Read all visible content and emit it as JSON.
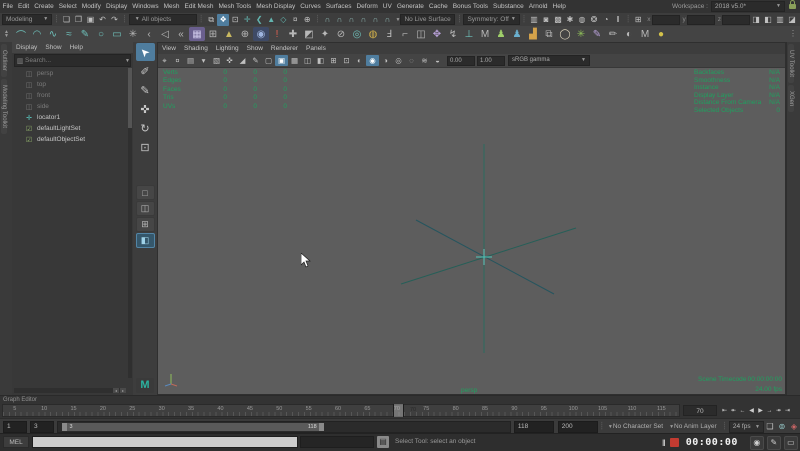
{
  "colors": {
    "accent": "#5285a6",
    "hud_green": "#1fa15f",
    "icon_teal": "#63b4af",
    "viewport_bg": "#5d5d5d",
    "record_red": "#c23b31"
  },
  "menubar": {
    "menus": [
      "File",
      "Edit",
      "Create",
      "Select",
      "Modify",
      "Display",
      "Windows",
      "Mesh",
      "Edit Mesh",
      "Mesh Tools",
      "Mesh Display",
      "Curves",
      "Surfaces",
      "Deform",
      "UV",
      "Generate",
      "Cache",
      "Bonus Tools",
      "Substance",
      "Arnold",
      "Help"
    ],
    "workspace_label": "Workspace :",
    "workspace_value": "2018 v5.0*"
  },
  "statusline": {
    "mode": "Modeling",
    "file_icons": [
      {
        "n": "new-scene-icon",
        "g": "❏"
      },
      {
        "n": "open-scene-icon",
        "g": "❐"
      },
      {
        "n": "save-scene-icon",
        "g": "▣"
      },
      {
        "n": "undo-icon",
        "g": "↶"
      },
      {
        "n": "redo-icon",
        "g": "↷"
      }
    ],
    "selection_filter": "All objects",
    "mask_icons": [
      {
        "n": "select-by-hierarchy-icon",
        "g": "⧉"
      },
      {
        "n": "select-by-object-icon",
        "g": "❖",
        "hl": 1
      },
      {
        "n": "select-by-component-icon",
        "g": "⊡"
      }
    ],
    "toggle_icons": [
      {
        "n": "soft-select-icon",
        "g": "✛",
        "c": "#63b4af"
      },
      {
        "n": "reflection-icon",
        "g": "❮",
        "c": "#63b4af"
      },
      {
        "n": "preserve-children-icon",
        "g": "▲",
        "c": "#63b4af"
      },
      {
        "n": "preserve-uv-icon",
        "g": "◇",
        "c": "#63b4af"
      },
      {
        "n": "lock-selection-icon",
        "g": "¤"
      },
      {
        "n": "track-selection-icon",
        "g": "⊕"
      }
    ],
    "snap_icons": [
      {
        "n": "snap-to-grids-icon",
        "g": "∩",
        "c": "#8fb8b4"
      },
      {
        "n": "snap-to-curves-icon",
        "g": "∩",
        "c": "#8fb8b4"
      },
      {
        "n": "snap-to-points-icon",
        "g": "∩",
        "c": "#8fb8b4"
      },
      {
        "n": "snap-to-projected-center-icon",
        "g": "∩",
        "c": "#8fb8b4"
      },
      {
        "n": "snap-to-view-planes-icon",
        "g": "∩",
        "c": "#8fb8b4"
      },
      {
        "n": "make-live-icon",
        "g": "∩",
        "c": "#8fb8b4"
      }
    ],
    "live_surface": "No Live Surface",
    "symmetry": "Symmetry: Off",
    "render_icons": [
      {
        "n": "render-view-icon",
        "g": "▥"
      },
      {
        "n": "render-current-frame-icon",
        "g": "◙"
      },
      {
        "n": "ipr-render-icon",
        "g": "▩"
      },
      {
        "n": "render-settings-icon",
        "g": "✱"
      },
      {
        "n": "hypershade-icon",
        "g": "◍"
      },
      {
        "n": "light-editor-icon",
        "g": "❂"
      },
      {
        "n": "render-setup-icon",
        "g": "◔"
      },
      {
        "n": "pause-viewport-icon",
        "g": "‖"
      }
    ],
    "coord_icon": "⊞",
    "coord_labels": [
      "x",
      "y",
      "z"
    ],
    "right_icons": [
      {
        "n": "attribute-editor-toggle-icon",
        "g": "◨"
      },
      {
        "n": "tool-settings-toggle-icon",
        "g": "◧"
      },
      {
        "n": "channel-box-toggle-icon",
        "g": "▥"
      },
      {
        "n": "workspace-controls-icon",
        "g": "◪"
      }
    ]
  },
  "shelf": {
    "icons": [
      {
        "n": "two-point-arc-tool",
        "g": "⌒",
        "c": "#6ec0ba"
      },
      {
        "n": "three-point-arc-tool",
        "g": "◠",
        "c": "#6ec0ba"
      },
      {
        "n": "cv-curve-tool",
        "g": "∿",
        "c": "#6ec0ba"
      },
      {
        "n": "ep-curve-tool",
        "g": "≈",
        "c": "#6ec0ba"
      },
      {
        "n": "pencil-curve-tool",
        "g": "✎",
        "c": "#6ec0ba"
      },
      {
        "n": "nurbs-circle-tool",
        "g": "○",
        "c": "#6ec0ba"
      },
      {
        "n": "nurbs-square-tool",
        "g": "▭",
        "c": "#6ec0ba"
      },
      {
        "n": "text-curves-tool",
        "g": "✳"
      },
      {
        "n": "attach-curves-tool",
        "g": "‹"
      },
      {
        "n": "detach-curves-tool",
        "g": "◁"
      },
      {
        "n": "insert-knot-tool",
        "g": "«"
      },
      {
        "n": "bonus-grid-tool",
        "g": "▦",
        "c": "#cfc8ea",
        "b": "#6a5f8e"
      },
      {
        "n": "lattice-tool",
        "g": "⊞"
      },
      {
        "n": "sculpt-tool",
        "g": "▲",
        "c": "#c8b860"
      },
      {
        "n": "wrap-deformer-tool",
        "g": "⊕"
      },
      {
        "n": "substance-node-tool",
        "g": "◉",
        "c": "#9fb6e0",
        "b": "#3e4a66"
      },
      {
        "n": "warning-badge-tool",
        "g": "!",
        "c": "#e06050"
      },
      {
        "n": "cluster-tool",
        "g": "✚"
      },
      {
        "n": "blend-shape-tool",
        "g": "◩"
      },
      {
        "n": "skin-bind-tool",
        "g": "✦"
      },
      {
        "n": "nonlinear-deformer-tool",
        "g": "⊘"
      },
      {
        "n": "jiggle-deformer-tool",
        "g": "◎",
        "c": "#6ec0ba"
      },
      {
        "n": "cluster-handle-tool",
        "g": "◍",
        "c": "#d4b24a"
      },
      {
        "n": "ik-handle-tool",
        "g": "Ⅎ"
      },
      {
        "n": "joint-tool",
        "g": "⌐"
      },
      {
        "n": "mirror-joint-tool",
        "g": "◫"
      },
      {
        "n": "hik-character-tool",
        "g": "✥",
        "c": "#b8a0d8"
      },
      {
        "n": "ik-spline-tool",
        "g": "↯"
      },
      {
        "n": "mash-network-tool",
        "g": "⊥",
        "c": "#6ec0ba"
      },
      {
        "n": "mash-editor-tool",
        "g": "M"
      },
      {
        "n": "trs-node-tool",
        "g": "♟",
        "c": "#9fcf6a"
      },
      {
        "n": "mp-node-tool",
        "g": "♟",
        "c": "#6ab0cf"
      },
      {
        "n": "profiler-tool",
        "g": "▟",
        "c": "#d4a24a"
      },
      {
        "n": "lattice-pair-tool",
        "g": "⧉"
      },
      {
        "n": "xgen-egg-tool",
        "g": "◯",
        "c": "#d8d0b8"
      },
      {
        "n": "xgen-plant-tool",
        "g": "✳",
        "c": "#8fbf5a"
      },
      {
        "n": "paint-effects-brush-tool",
        "g": "✎",
        "c": "#b8a0d8"
      },
      {
        "n": "paint-effects-preset-tool",
        "g": "✏"
      },
      {
        "n": "yin-yang-tool",
        "g": "◐"
      },
      {
        "n": "mash-m-tool",
        "g": "M"
      },
      {
        "n": "sphere-preset-tool",
        "g": "●",
        "c": "#d4c24a"
      }
    ]
  },
  "side_tabs": {
    "left": [
      "Outliner",
      "Modeling Toolkit"
    ],
    "right": [
      "UV Toolkit",
      "XGen"
    ]
  },
  "outliner": {
    "menus": [
      "Display",
      "Show",
      "Help"
    ],
    "search_placeholder": "Search...",
    "items": [
      {
        "label": "persp",
        "icon": "camera-icon",
        "ig": "◫",
        "ic": "#777",
        "cls": "dim"
      },
      {
        "label": "top",
        "icon": "camera-icon",
        "ig": "◫",
        "ic": "#777",
        "cls": "dim"
      },
      {
        "label": "front",
        "icon": "camera-icon",
        "ig": "◫",
        "ic": "#777",
        "cls": "dim"
      },
      {
        "label": "side",
        "icon": "camera-icon",
        "ig": "◫",
        "ic": "#777",
        "cls": "dim"
      },
      {
        "label": "locator1",
        "icon": "locator-icon",
        "ig": "✛",
        "ic": "#5bc8c0"
      },
      {
        "label": "defaultLightSet",
        "icon": "set-icon",
        "ig": "☑",
        "ic": "#8fae6a"
      },
      {
        "label": "defaultObjectSet",
        "icon": "set-icon",
        "ig": "☑",
        "ic": "#8fae6a"
      }
    ]
  },
  "toolbox": {
    "tools": [
      {
        "n": "select-tool",
        "g": "➤",
        "cls": "rot",
        "hl": 1
      },
      {
        "n": "lasso-tool",
        "g": "✐"
      },
      {
        "n": "paint-select-tool",
        "g": "✎"
      },
      {
        "n": "move-tool",
        "g": "✜"
      },
      {
        "n": "rotate-tool",
        "g": "↻"
      },
      {
        "n": "scale-tool",
        "g": "⊡"
      }
    ],
    "layouts": [
      {
        "n": "layout-single-pane-button",
        "g": "□"
      },
      {
        "n": "layout-two-panes-button",
        "g": "◫"
      },
      {
        "n": "layout-four-panes-button",
        "g": "⊞"
      },
      {
        "n": "layout-outliner-persp-button",
        "g": "◧",
        "hl": 1
      }
    ],
    "logo": "M"
  },
  "viewport": {
    "menus": [
      "View",
      "Shading",
      "Lighting",
      "Show",
      "Renderer",
      "Panels"
    ],
    "toolbar_icons": [
      {
        "n": "select-camera-icon",
        "g": "⌖"
      },
      {
        "n": "lock-camera-icon",
        "g": "¤"
      },
      {
        "n": "camera-attributes-icon",
        "g": "▤"
      },
      {
        "n": "bookmarks-icon",
        "g": "▾"
      },
      {
        "n": "image-plane-icon",
        "g": "▧"
      },
      {
        "n": "two-d-pan-zoom-icon",
        "g": "✜"
      },
      {
        "n": "oversampling-icon",
        "g": "◢"
      },
      {
        "n": "grease-pencil-icon",
        "g": "✎"
      },
      {
        "n": "wireframe-mode-icon",
        "g": "▢"
      },
      {
        "n": "shaded-mode-icon",
        "g": "▣",
        "hl": 1
      },
      {
        "n": "textured-mode-icon",
        "g": "▦"
      },
      {
        "n": "wireframe-on-shaded-icon",
        "g": "◫"
      },
      {
        "n": "default-material-icon",
        "g": "◧"
      },
      {
        "n": "xray-icon",
        "g": "⊞"
      },
      {
        "n": "isolate-select-icon",
        "g": "⊡"
      },
      {
        "n": "use-default-lighting-icon",
        "g": "◐"
      },
      {
        "n": "use-all-lights-icon",
        "g": "◉",
        "hl": 1
      },
      {
        "n": "shadows-icon",
        "g": "◑"
      },
      {
        "n": "screen-space-ao-icon",
        "g": "◎"
      },
      {
        "n": "motion-blur-icon",
        "g": "◌"
      },
      {
        "n": "multisample-aa-icon",
        "g": "≋"
      },
      {
        "n": "depth-of-field-icon",
        "g": "◒"
      }
    ],
    "exposure": "0.00",
    "gamma": "1.00",
    "colorspace": "sRGB gamma",
    "hud_left": [
      {
        "label": "Verts",
        "v1": "0",
        "v2": "0",
        "v3": "0"
      },
      {
        "label": "Edges",
        "v1": "0",
        "v2": "0",
        "v3": "0"
      },
      {
        "label": "Faces",
        "v1": "0",
        "v2": "0",
        "v3": "0"
      },
      {
        "label": "Tris",
        "v1": "0",
        "v2": "0",
        "v3": "0"
      },
      {
        "label": "UVs",
        "v1": "0",
        "v2": "0",
        "v3": "0"
      }
    ],
    "hud_right": [
      {
        "label": "Backfaces",
        "value": "N/A"
      },
      {
        "label": "Smoothness",
        "value": "N/A"
      },
      {
        "label": "Instance",
        "value": "N/A"
      },
      {
        "label": "Display Layer",
        "value": "N/A"
      },
      {
        "label": "Distance From Camera",
        "value": "N/A"
      },
      {
        "label": "Selected Objects",
        "value": "0"
      }
    ],
    "camera_label": "persp",
    "hud_bottom_right": {
      "timecode_label": "Scene Timecode",
      "timecode": "00:00:00:00",
      "fps": "24.00 fps"
    }
  },
  "graph_editor": {
    "label": "Graph Editor"
  },
  "timeline": {
    "tick_labels": [
      "5",
      "10",
      "15",
      "20",
      "25",
      "30",
      "35",
      "40",
      "45",
      "50",
      "55",
      "60",
      "65",
      "70",
      "75",
      "80",
      "85",
      "90",
      "95",
      "100",
      "105",
      "110",
      "115"
    ],
    "current_frame": "70",
    "anim_start": "1",
    "play_start": "3",
    "play_end": "118",
    "anim_end": "200",
    "handle_start_label": "3",
    "handle_end_label": "118",
    "character_set": "No Character Set",
    "anim_layer": "No Anim Layer",
    "fps": "24 fps",
    "transport": [
      {
        "n": "go-to-start-button",
        "g": "⇤"
      },
      {
        "n": "step-back-key-button",
        "g": "↞"
      },
      {
        "n": "step-back-frame-button",
        "g": "←"
      },
      {
        "n": "play-backwards-button",
        "g": "◀"
      },
      {
        "n": "play-forwards-button",
        "g": "▶"
      },
      {
        "n": "step-forward-frame-button",
        "g": "→"
      },
      {
        "n": "step-forward-key-button",
        "g": "↠"
      },
      {
        "n": "go-to-end-button",
        "g": "⇥"
      }
    ],
    "right_icons": [
      {
        "n": "speech-bubble-icon",
        "g": "❑"
      },
      {
        "n": "playback-options-icon",
        "g": "⊚",
        "c": "#9cc"
      },
      {
        "n": "auto-key-icon",
        "g": "◈",
        "c": "#c66"
      }
    ]
  },
  "command_line": {
    "mel_label": "MEL",
    "help_text": "Select Tool: select an object"
  },
  "recorder": {
    "timecode": "00:00:00",
    "icons": [
      {
        "n": "camera-capture-icon",
        "g": "◉"
      },
      {
        "n": "annotate-pencil-icon",
        "g": "✎"
      },
      {
        "n": "display-monitor-icon",
        "g": "▭"
      }
    ]
  }
}
